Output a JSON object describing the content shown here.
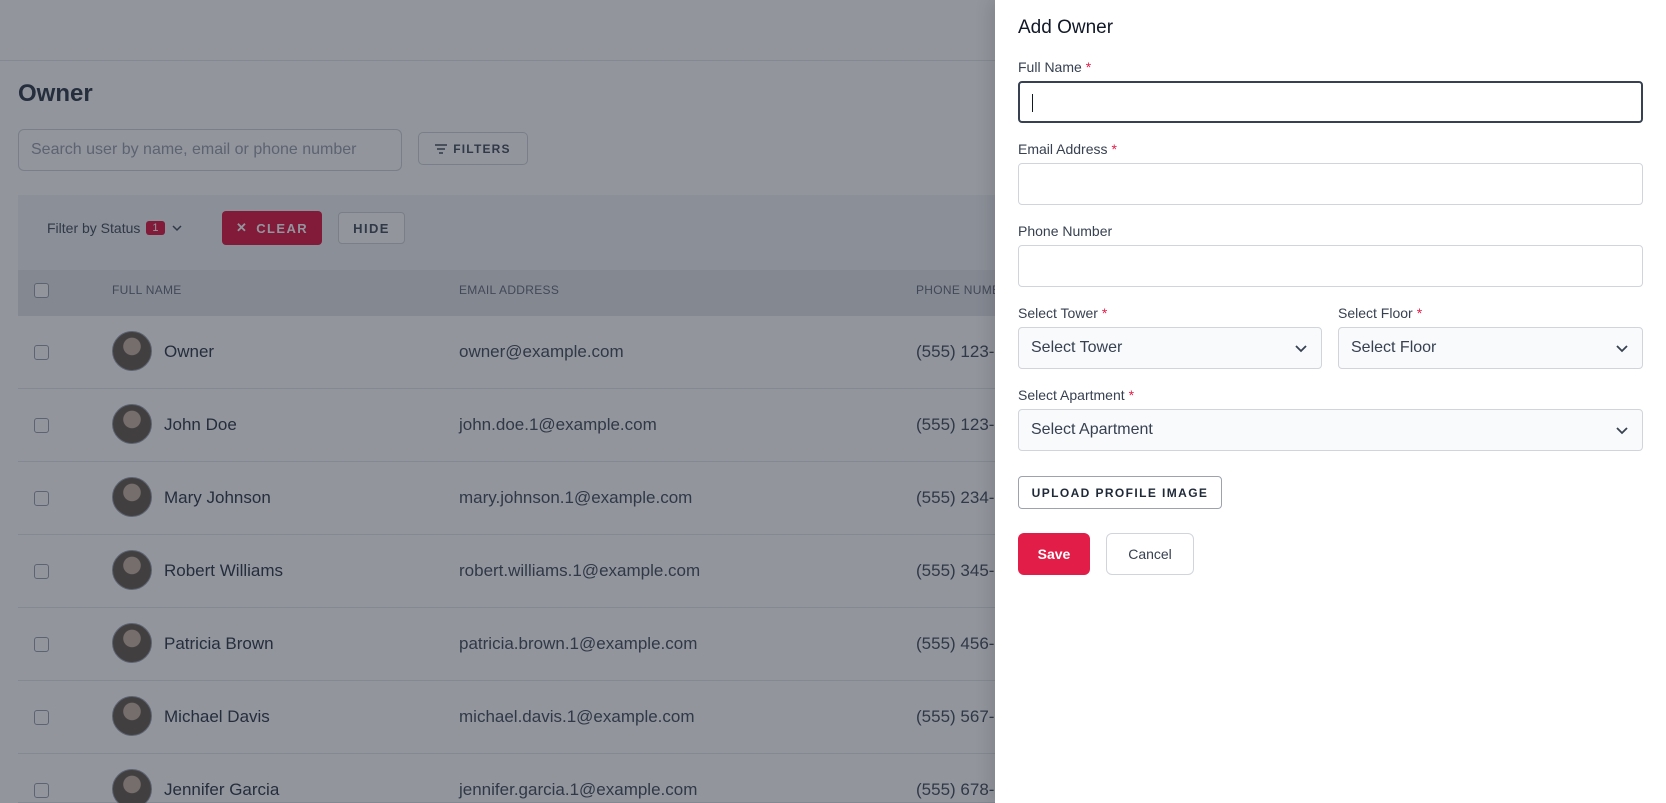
{
  "page": {
    "title": "Owner",
    "search_placeholder": "Search user by name, email or phone number",
    "filters_label": "FILTERS",
    "filter_status_label": "Filter by Status",
    "filter_status_count": "1",
    "clear_label": "CLEAR",
    "hide_label": "HIDE"
  },
  "table": {
    "columns": [
      "FULL NAME",
      "EMAIL ADDRESS",
      "PHONE NUMB"
    ],
    "rows": [
      {
        "name": "Owner",
        "email": "owner@example.com",
        "phone": "(555) 123-"
      },
      {
        "name": "John Doe",
        "email": "john.doe.1@example.com",
        "phone": "(555) 123-"
      },
      {
        "name": "Mary Johnson",
        "email": "mary.johnson.1@example.com",
        "phone": "(555) 234-"
      },
      {
        "name": "Robert Williams",
        "email": "robert.williams.1@example.com",
        "phone": "(555) 345-"
      },
      {
        "name": "Patricia Brown",
        "email": "patricia.brown.1@example.com",
        "phone": "(555) 456-"
      },
      {
        "name": "Michael Davis",
        "email": "michael.davis.1@example.com",
        "phone": "(555) 567-"
      },
      {
        "name": "Jennifer Garcia",
        "email": "jennifer.garcia.1@example.com",
        "phone": "(555) 678-"
      }
    ]
  },
  "drawer": {
    "title": "Add Owner",
    "full_name_label": "Full Name",
    "email_label": "Email Address",
    "phone_label": "Phone Number",
    "tower_label": "Select Tower",
    "tower_value": "Select Tower",
    "floor_label": "Select Floor",
    "floor_value": "Select Floor",
    "apartment_label": "Select Apartment",
    "apartment_value": "Select Apartment",
    "required_mark": "*",
    "upload_label": "UPLOAD PROFILE IMAGE",
    "save_label": "Save",
    "cancel_label": "Cancel"
  },
  "colors": {
    "accent": "#e11d48",
    "overlay": "#111827"
  }
}
